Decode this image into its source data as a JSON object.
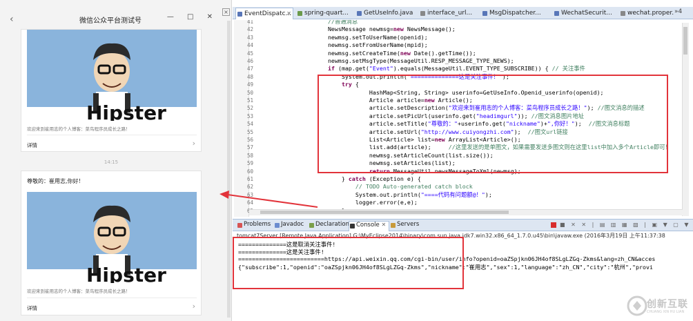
{
  "wechat": {
    "title": "微信公众平台测试号",
    "back_icon": "chevron-left-icon",
    "window_buttons": "—  □  ✕",
    "outer_close": "×",
    "time": "14:15",
    "cards": [
      {
        "title": "",
        "image_text": "Hipster",
        "desc": "欢迎来到崔用志的个人博客：菜鸟程序员成长之路！",
        "more": "详情"
      },
      {
        "title": "尊敬的：崔用志,你好！",
        "image_text": "Hipster",
        "desc": "欢迎来到崔用志的个人博客：菜鸟程序员成长之路！",
        "more": "详情"
      }
    ]
  },
  "eclipse": {
    "tabs": [
      {
        "label": "EventDispatc...",
        "active": true
      },
      {
        "label": "spring-quart...",
        "active": false
      },
      {
        "label": "GetUseInfo.java",
        "active": false
      },
      {
        "label": "interface_url...",
        "active": false
      },
      {
        "label": "MsgDispatcher...",
        "active": false
      },
      {
        "label": "WechatSecurit...",
        "active": false
      },
      {
        "label": "wechat.proper...",
        "active": false
      }
    ],
    "tabs_overflow": "»4",
    "code_lines": [
      {
        "n": "41",
        "text": "            //普通消息"
      },
      {
        "n": "42",
        "text": "            NewsMessage newmsg=new NewsMessage();"
      },
      {
        "n": "43",
        "text": "            newmsg.setToUserName(openid);"
      },
      {
        "n": "44",
        "text": "            newmsg.setFromUserName(mpid);"
      },
      {
        "n": "45",
        "text": "            newmsg.setCreateTime(new Date().getTime());"
      },
      {
        "n": "46",
        "text": "            newmsg.setMsgType(MessageUtil.RESP_MESSAGE_TYPE_NEWS);"
      },
      {
        "n": "47",
        "text": "            if (map.get(\"Event\").equals(MessageUtil.EVENT_TYPE_SUBSCRIBE)) { // 关注事件"
      },
      {
        "n": "48",
        "text": "                System.out.println(\"==============这是关注事件！\");"
      },
      {
        "n": "49",
        "text": "                try {"
      },
      {
        "n": "50",
        "text": "                        HashMap<String, String> userinfo=GetUseInfo.Openid_userinfo(openid);"
      },
      {
        "n": "51",
        "text": "                        Article article=new Article();"
      },
      {
        "n": "52",
        "text": "                        article.setDescription(\"欢迎来到崔用志的个人博客：菜鸟程序员成长之路！\"); //图文消息的描述"
      },
      {
        "n": "53",
        "text": "                        article.setPicUrl(userinfo.get(\"headimgurl\")); //图文消息图片地址"
      },
      {
        "n": "54",
        "text": "                        article.setTitle(\"尊敬的：\"+userinfo.get(\"nickname\")+\",你好！\");  //图文消息标题"
      },
      {
        "n": "55",
        "text": "                        article.setUrl(\"http://www.cuiyongzhi.com\");  //图文url链接"
      },
      {
        "n": "56",
        "text": "                        List<Article> list=new ArrayList<Article>();"
      },
      {
        "n": "57",
        "text": "                        list.add(article);     //这里发送的是单图文，如果需要发送多图文则在这里list中加入多个Article即可！"
      },
      {
        "n": "58",
        "text": "                        newmsg.setArticleCount(list.size());"
      },
      {
        "n": "59",
        "text": "                        newmsg.setArticles(list);"
      },
      {
        "n": "60",
        "text": "                        return MessageUtil.newsMessageToXml(newmsg);"
      },
      {
        "n": "61",
        "text": "                } catch (Exception e) {"
      },
      {
        "n": "62",
        "text": "                    // TODO Auto-generated catch block"
      },
      {
        "n": "63",
        "text": "                    System.out.println(\"====代码有问题额@！\");"
      },
      {
        "n": "64",
        "text": "                    logger.error(e,e);"
      },
      {
        "n": "65",
        "text": "                }"
      }
    ],
    "console_tabs": [
      {
        "label": "Problems",
        "active": false
      },
      {
        "label": "Javadoc",
        "active": false
      },
      {
        "label": "Declaration",
        "active": false
      },
      {
        "label": "Console",
        "active": true
      },
      {
        "label": "Servers",
        "active": false
      }
    ],
    "console_tools": "■ ✕ ✕ | ▤ ▥ ▦ ▧ | ▣ ▼ ▢ ▼",
    "console_info": "tomcat7Server [Remote Java Application] G:\\MyEclipse2014\\binary\\com.sun.java.jdk7.win32.x86_64_1.7.0.u45\\bin\\javaw.exe (2016年3月19日 上午11:37:38",
    "console_lines": [
      "==============这是取消关注事件!",
      "==============这是关注事件!",
      "=========================https://api.weixin.qq.com/cgi-bin/user/info?openid=oaZSpjkn06JH4of8SLgLZGq-Zkms&lang=zh_CN&acces",
      "{\"subscribe\":1,\"openid\":\"oaZSpjkn06JH4of8SLgLZGq-Zkms\",\"nickname\":\"崔用志\",\"sex\":1,\"language\":\"zh_CN\",\"city\":\"杭州\",\"provi"
    ]
  },
  "watermark": {
    "text": "创新互联",
    "sub": "CHUANG XIN HU LIAN"
  },
  "colors": {
    "red_annotation": "#e2333a",
    "keyword": "#7f0055",
    "string": "#2a00ff",
    "comment": "#3f7f5f"
  }
}
